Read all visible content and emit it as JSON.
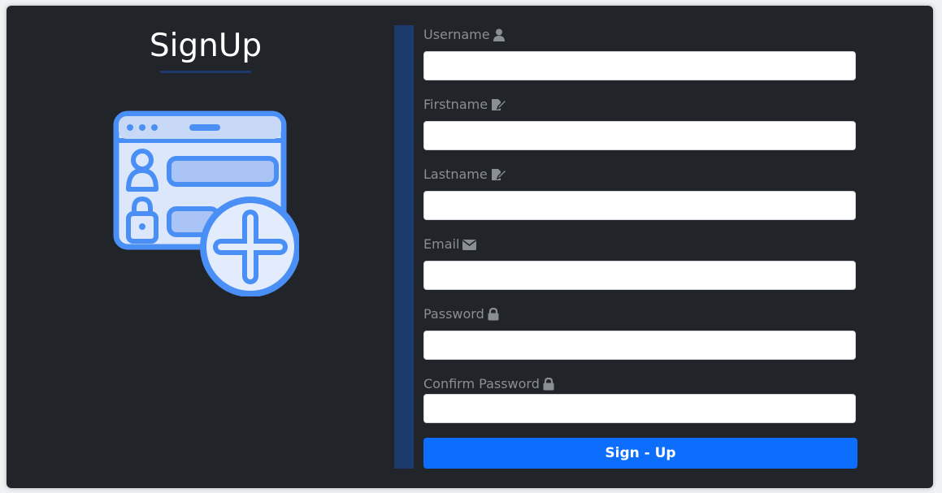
{
  "page": {
    "title": "SignUp"
  },
  "form": {
    "fields": [
      {
        "label": "Username",
        "icon": "user-icon",
        "value": ""
      },
      {
        "label": "Firstname",
        "icon": "edit-icon",
        "value": ""
      },
      {
        "label": "Lastname",
        "icon": "edit-icon",
        "value": ""
      },
      {
        "label": "Email",
        "icon": "envelope-icon",
        "value": ""
      },
      {
        "label": "Password",
        "icon": "lock-icon",
        "value": ""
      },
      {
        "label": "Confirm Password",
        "icon": "lock-icon",
        "value": ""
      }
    ],
    "submit_label": "Sign - Up"
  },
  "colors": {
    "card_bg": "#212429",
    "accent_bar": "#1c3a6b",
    "button": "#0d6efd",
    "label_text": "#8a8e95",
    "illustration_blue": "#4a8ff5"
  }
}
